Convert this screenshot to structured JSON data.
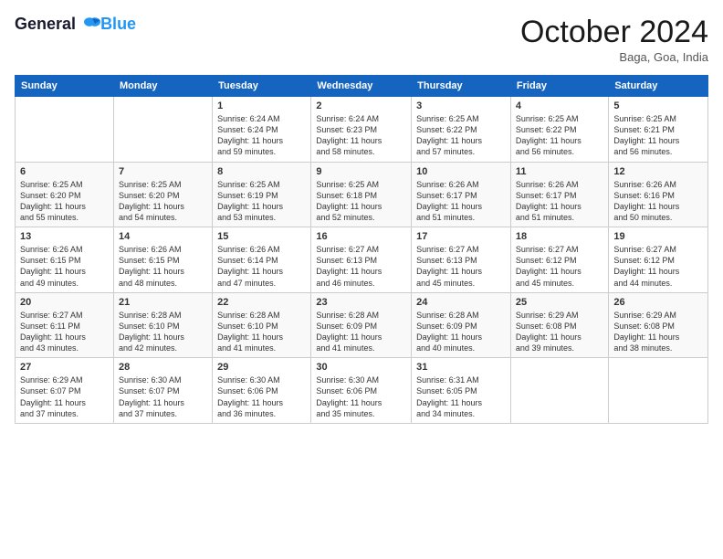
{
  "header": {
    "logo_line1": "General",
    "logo_line2": "Blue",
    "month": "October 2024",
    "location": "Baga, Goa, India"
  },
  "days_of_week": [
    "Sunday",
    "Monday",
    "Tuesday",
    "Wednesday",
    "Thursday",
    "Friday",
    "Saturday"
  ],
  "weeks": [
    [
      {
        "day": "",
        "content": ""
      },
      {
        "day": "",
        "content": ""
      },
      {
        "day": "1",
        "content": "Sunrise: 6:24 AM\nSunset: 6:24 PM\nDaylight: 11 hours\nand 59 minutes."
      },
      {
        "day": "2",
        "content": "Sunrise: 6:24 AM\nSunset: 6:23 PM\nDaylight: 11 hours\nand 58 minutes."
      },
      {
        "day": "3",
        "content": "Sunrise: 6:25 AM\nSunset: 6:22 PM\nDaylight: 11 hours\nand 57 minutes."
      },
      {
        "day": "4",
        "content": "Sunrise: 6:25 AM\nSunset: 6:22 PM\nDaylight: 11 hours\nand 56 minutes."
      },
      {
        "day": "5",
        "content": "Sunrise: 6:25 AM\nSunset: 6:21 PM\nDaylight: 11 hours\nand 56 minutes."
      }
    ],
    [
      {
        "day": "6",
        "content": "Sunrise: 6:25 AM\nSunset: 6:20 PM\nDaylight: 11 hours\nand 55 minutes."
      },
      {
        "day": "7",
        "content": "Sunrise: 6:25 AM\nSunset: 6:20 PM\nDaylight: 11 hours\nand 54 minutes."
      },
      {
        "day": "8",
        "content": "Sunrise: 6:25 AM\nSunset: 6:19 PM\nDaylight: 11 hours\nand 53 minutes."
      },
      {
        "day": "9",
        "content": "Sunrise: 6:25 AM\nSunset: 6:18 PM\nDaylight: 11 hours\nand 52 minutes."
      },
      {
        "day": "10",
        "content": "Sunrise: 6:26 AM\nSunset: 6:17 PM\nDaylight: 11 hours\nand 51 minutes."
      },
      {
        "day": "11",
        "content": "Sunrise: 6:26 AM\nSunset: 6:17 PM\nDaylight: 11 hours\nand 51 minutes."
      },
      {
        "day": "12",
        "content": "Sunrise: 6:26 AM\nSunset: 6:16 PM\nDaylight: 11 hours\nand 50 minutes."
      }
    ],
    [
      {
        "day": "13",
        "content": "Sunrise: 6:26 AM\nSunset: 6:15 PM\nDaylight: 11 hours\nand 49 minutes."
      },
      {
        "day": "14",
        "content": "Sunrise: 6:26 AM\nSunset: 6:15 PM\nDaylight: 11 hours\nand 48 minutes."
      },
      {
        "day": "15",
        "content": "Sunrise: 6:26 AM\nSunset: 6:14 PM\nDaylight: 11 hours\nand 47 minutes."
      },
      {
        "day": "16",
        "content": "Sunrise: 6:27 AM\nSunset: 6:13 PM\nDaylight: 11 hours\nand 46 minutes."
      },
      {
        "day": "17",
        "content": "Sunrise: 6:27 AM\nSunset: 6:13 PM\nDaylight: 11 hours\nand 45 minutes."
      },
      {
        "day": "18",
        "content": "Sunrise: 6:27 AM\nSunset: 6:12 PM\nDaylight: 11 hours\nand 45 minutes."
      },
      {
        "day": "19",
        "content": "Sunrise: 6:27 AM\nSunset: 6:12 PM\nDaylight: 11 hours\nand 44 minutes."
      }
    ],
    [
      {
        "day": "20",
        "content": "Sunrise: 6:27 AM\nSunset: 6:11 PM\nDaylight: 11 hours\nand 43 minutes."
      },
      {
        "day": "21",
        "content": "Sunrise: 6:28 AM\nSunset: 6:10 PM\nDaylight: 11 hours\nand 42 minutes."
      },
      {
        "day": "22",
        "content": "Sunrise: 6:28 AM\nSunset: 6:10 PM\nDaylight: 11 hours\nand 41 minutes."
      },
      {
        "day": "23",
        "content": "Sunrise: 6:28 AM\nSunset: 6:09 PM\nDaylight: 11 hours\nand 41 minutes."
      },
      {
        "day": "24",
        "content": "Sunrise: 6:28 AM\nSunset: 6:09 PM\nDaylight: 11 hours\nand 40 minutes."
      },
      {
        "day": "25",
        "content": "Sunrise: 6:29 AM\nSunset: 6:08 PM\nDaylight: 11 hours\nand 39 minutes."
      },
      {
        "day": "26",
        "content": "Sunrise: 6:29 AM\nSunset: 6:08 PM\nDaylight: 11 hours\nand 38 minutes."
      }
    ],
    [
      {
        "day": "27",
        "content": "Sunrise: 6:29 AM\nSunset: 6:07 PM\nDaylight: 11 hours\nand 37 minutes."
      },
      {
        "day": "28",
        "content": "Sunrise: 6:30 AM\nSunset: 6:07 PM\nDaylight: 11 hours\nand 37 minutes."
      },
      {
        "day": "29",
        "content": "Sunrise: 6:30 AM\nSunset: 6:06 PM\nDaylight: 11 hours\nand 36 minutes."
      },
      {
        "day": "30",
        "content": "Sunrise: 6:30 AM\nSunset: 6:06 PM\nDaylight: 11 hours\nand 35 minutes."
      },
      {
        "day": "31",
        "content": "Sunrise: 6:31 AM\nSunset: 6:05 PM\nDaylight: 11 hours\nand 34 minutes."
      },
      {
        "day": "",
        "content": ""
      },
      {
        "day": "",
        "content": ""
      }
    ]
  ]
}
